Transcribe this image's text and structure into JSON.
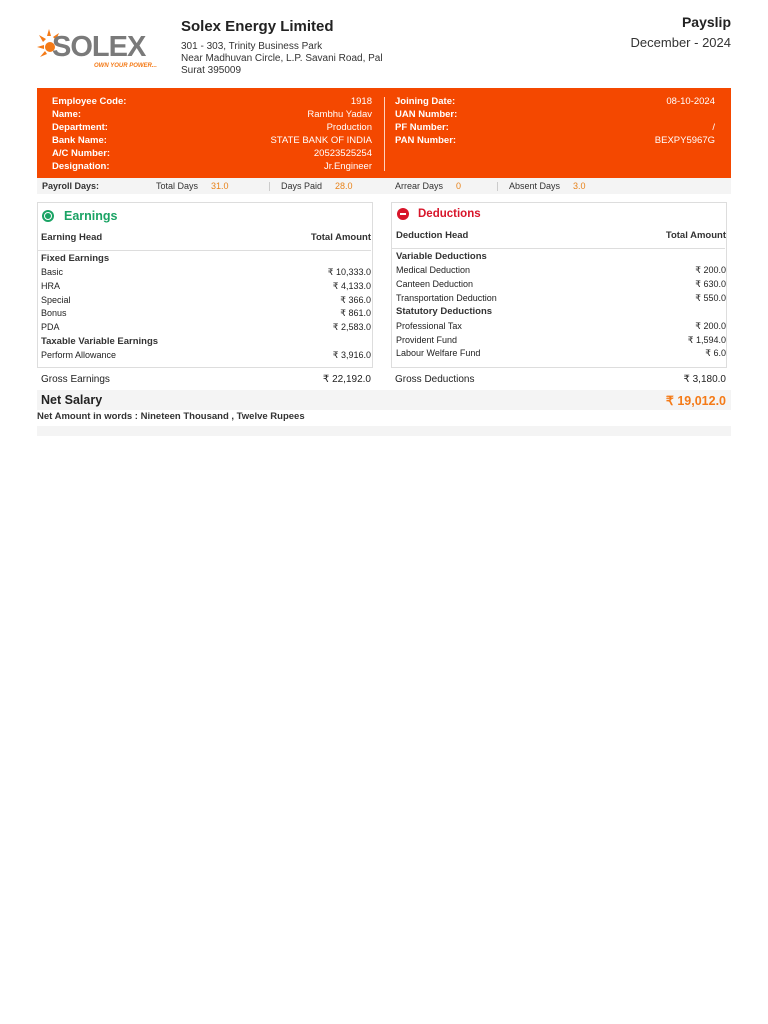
{
  "company": {
    "name": "Solex Energy Limited",
    "address_line1": "301 - 303, Trinity Business Park",
    "address_line2": "Near Madhuvan Circle, L.P. Savani Road, Pal",
    "address_line3": "Surat 395009",
    "logo_text": "SOLEX",
    "logo_tagline": "OWN YOUR POWER..."
  },
  "payslip": {
    "title": "Payslip",
    "period": "December - 2024"
  },
  "employee": {
    "left": [
      {
        "label": "Employee Code:",
        "value": "1918"
      },
      {
        "label": "Name:",
        "value": "Rambhu Yadav"
      },
      {
        "label": "Department:",
        "value": "Production"
      },
      {
        "label": "Bank Name:",
        "value": "STATE BANK OF INDIA"
      },
      {
        "label": "A/C Number:",
        "value": "20523525254"
      },
      {
        "label": "Designation:",
        "value": "Jr.Engineer"
      }
    ],
    "right": [
      {
        "label": "Joining Date:",
        "value": "08-10-2024"
      },
      {
        "label": "UAN Number:",
        "value": ""
      },
      {
        "label": "PF Number:",
        "value": "/"
      },
      {
        "label": "PAN Number:",
        "value": "BEXPY5967G"
      }
    ]
  },
  "payroll_days": {
    "label": "Payroll Days:",
    "total_days_label": "Total Days",
    "total_days": "31.0",
    "days_paid_label": "Days Paid",
    "days_paid": "28.0",
    "arrear_days_label": "Arrear Days",
    "arrear_days": "0",
    "absent_days_label": "Absent Days",
    "absent_days": "3.0"
  },
  "earnings": {
    "title": "Earnings",
    "head_label": "Earning Head",
    "amount_label": "Total Amount",
    "fixed_title": "Fixed Earnings",
    "fixed": [
      {
        "label": "Basic",
        "value": "₹ 10,333.0"
      },
      {
        "label": "HRA",
        "value": "₹ 4,133.0"
      },
      {
        "label": "Special",
        "value": "₹ 366.0"
      },
      {
        "label": "Bonus",
        "value": "₹ 861.0"
      },
      {
        "label": "PDA",
        "value": "₹ 2,583.0"
      }
    ],
    "variable_title": "Taxable Variable Earnings",
    "variable": [
      {
        "label": "Perform Allowance",
        "value": "₹ 3,916.0"
      }
    ],
    "gross_label": "Gross Earnings",
    "gross_value": "₹ 22,192.0"
  },
  "deductions": {
    "title": "Deductions",
    "head_label": "Deduction Head",
    "amount_label": "Total Amount",
    "variable_title": "Variable Deductions",
    "variable": [
      {
        "label": "Medical Deduction",
        "value": "₹ 200.0"
      },
      {
        "label": "Canteen Deduction",
        "value": "₹ 630.0"
      },
      {
        "label": "Transportation Deduction",
        "value": "₹ 550.0"
      }
    ],
    "statutory_title": "Statutory Deductions",
    "statutory": [
      {
        "label": "Professional Tax",
        "value": "₹ 200.0"
      },
      {
        "label": "Provident Fund",
        "value": "₹ 1,594.0"
      },
      {
        "label": "Labour Welfare Fund",
        "value": "₹ 6.0"
      }
    ],
    "gross_label": "Gross Deductions",
    "gross_value": "₹ 3,180.0"
  },
  "net": {
    "label": "Net Salary",
    "value": "₹ 19,012.0",
    "words": "Net Amount in words : Nineteen Thousand , Twelve Rupees"
  },
  "colors": {
    "brand_orange": "#f44800",
    "earnings_green": "#1aa364",
    "deductions_red": "#d8152a",
    "net_orange": "#f47a17"
  }
}
